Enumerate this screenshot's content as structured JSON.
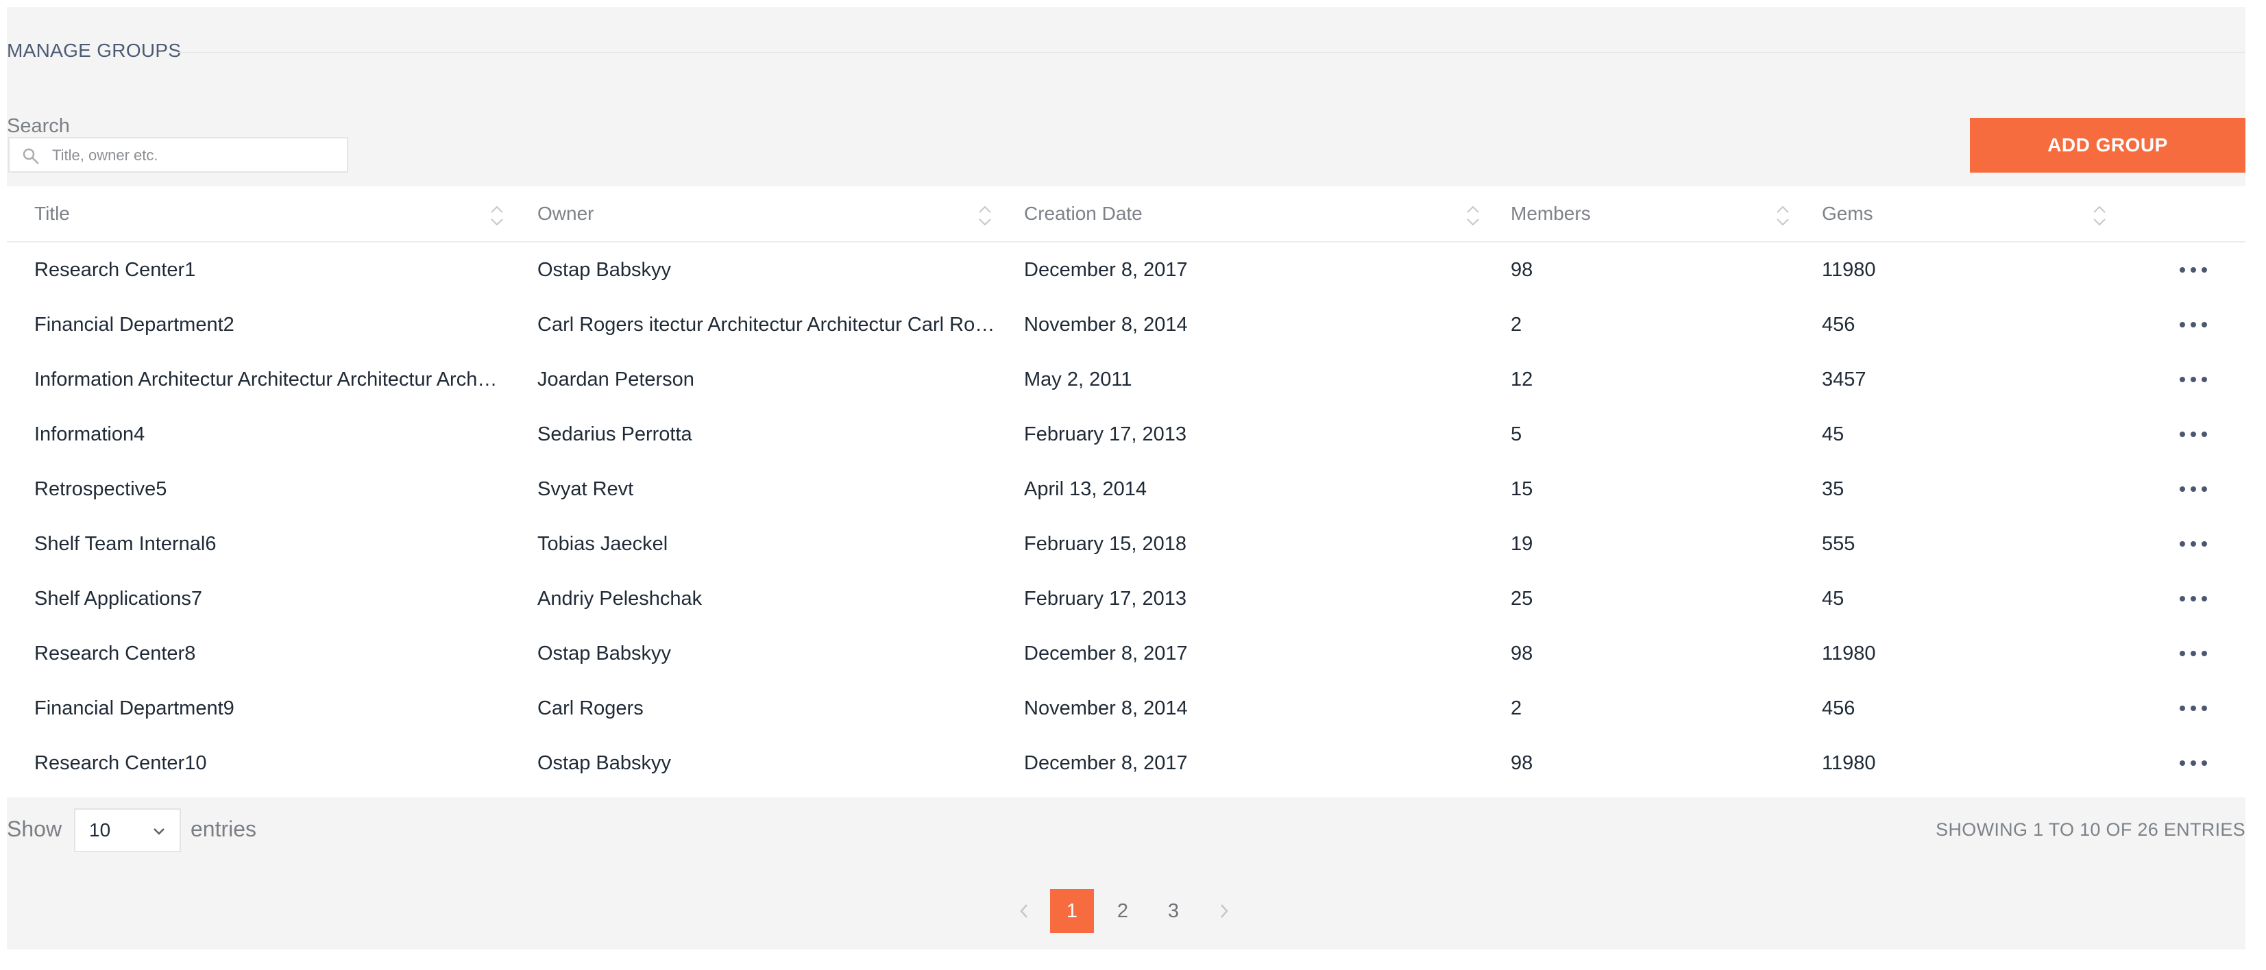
{
  "header": {
    "title": "MANAGE GROUPS"
  },
  "search": {
    "label": "Search",
    "placeholder": "Title, owner etc."
  },
  "actions": {
    "add_group_label": "ADD GROUP"
  },
  "table": {
    "columns": [
      "Title",
      "Owner",
      "Creation Date",
      "Members",
      "Gems"
    ],
    "rows": [
      [
        "Research Center1",
        "Ostap Babskyy",
        "December 8, 2017",
        "98",
        "11980"
      ],
      [
        "Financial Department2",
        "Carl Rogers itectur Architectur Architectur Carl Ro…",
        "November 8, 2014",
        "2",
        "456"
      ],
      [
        "Information Architectur Architectur Architectur Arch…",
        "Joardan Peterson",
        "May 2, 2011",
        "12",
        "3457"
      ],
      [
        "Information4",
        "Sedarius Perrotta",
        "February 17, 2013",
        "5",
        "45"
      ],
      [
        "Retrospective5",
        "Svyat Revt",
        "April 13, 2014",
        "15",
        "35"
      ],
      [
        "Shelf Team Internal6",
        "Tobias Jaeckel",
        "February 15, 2018",
        "19",
        "555"
      ],
      [
        "Shelf Applications7",
        "Andriy Peleshchak",
        "February 17, 2013",
        "25",
        "45"
      ],
      [
        "Research Center8",
        "Ostap Babskyy",
        "December 8, 2017",
        "98",
        "11980"
      ],
      [
        "Financial Department9",
        "Carl Rogers",
        "November 8, 2014",
        "2",
        "456"
      ],
      [
        "Research Center10",
        "Ostap Babskyy",
        "December 8, 2017",
        "98",
        "11980"
      ]
    ],
    "row_action_icon": "more-horizontal-icon"
  },
  "footer": {
    "show_label": "Show",
    "page_size": "10",
    "entries_label": "entries",
    "summary": "SHOWING 1 TO 10 OF 26 ENTRIES"
  },
  "pagination": {
    "pages": [
      "1",
      "2",
      "3"
    ],
    "current": "1",
    "prev_icon": "chevron-left-icon",
    "next_icon": "chevron-right-icon"
  },
  "colors": {
    "accent": "#f76c3f",
    "panel_bg": "#f4f4f4",
    "text_primary": "#1f2a36",
    "text_muted": "#7d8288",
    "title": "#4c5b73"
  }
}
